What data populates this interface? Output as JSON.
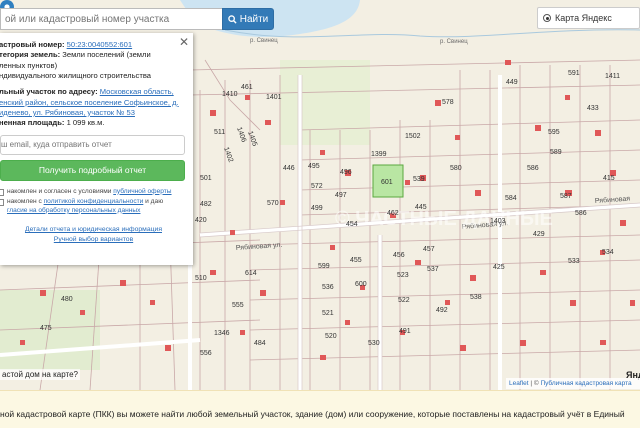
{
  "search": {
    "placeholder": "ой или кадастровый номер участка",
    "button_label": "Найти"
  },
  "map_type": {
    "label": "Карта Яндекс"
  },
  "panel": {
    "cadastral_label": "астровый номер:",
    "cadastral_value": "50:23:0040552:601",
    "category_label": "тегория земель:",
    "category_value_1": "Земли поселений (земли",
    "category_value_2": "ленных пунктов)",
    "use_value": "ндивидуального жилищного строительства",
    "address_label": "льный участок по адресу:",
    "address_line_1": "Московская область,",
    "address_line_2": "енский район, сельское поселение Софьинское, д.",
    "address_line_3": "иденево, ул. Рябиновая, участок № 53",
    "area_label": "ненная площадь:",
    "area_value": "1 099 кв.м.",
    "email_placeholder": "ш email, куда отправить отчет",
    "report_button": "Получить подробный отчет",
    "consent_1_a": "накомлен и согласен с условиями",
    "consent_1_link": "публичной оферты",
    "consent_2_a": "накомлен с",
    "consent_2_link": "политикой конфиденциальности",
    "consent_2_b": "и даю",
    "consent_3_link": "гласие на обработку персональных данных",
    "details_link": "Детали отчета и юридическая информация",
    "manual_link": "Ручной выбор вариантов",
    "close": "✕"
  },
  "map": {
    "river_label_1": "р. Свинец",
    "river_label_2": "р. Свинец",
    "street_1": "Рябиновая ул.",
    "street_2": "Рябиновая ул.",
    "street_3": "Рябиновая",
    "watermark": "© ЧАСТНЫЕ ДАННЫЕ",
    "yandex_fragment": "Янде"
  },
  "question": "астой дом на карте?",
  "attribution": {
    "leaflet": "Leaflet",
    "sep": " | © ",
    "source": "Публичная кадастровая карта"
  },
  "bottom_text": "ной кадастровой карте (ПКК) вы можете найти любой земельный участок, здание (дом) или сооружение, которые поставлены на кадастровый учёт в Единый",
  "plots": [
    {
      "id": "p601",
      "label": "601"
    },
    {
      "id": "p1399",
      "label": "1399"
    },
    {
      "id": "p1502",
      "label": "1502"
    },
    {
      "id": "p539",
      "label": "539"
    },
    {
      "id": "p578",
      "label": "578"
    },
    {
      "id": "p449",
      "label": "449"
    },
    {
      "id": "p591",
      "label": "591"
    },
    {
      "id": "p1411",
      "label": "1411"
    },
    {
      "id": "p462",
      "label": "462"
    },
    {
      "id": "p456",
      "label": "456"
    },
    {
      "id": "p457",
      "label": "457"
    },
    {
      "id": "p537",
      "label": "537"
    },
    {
      "id": "p425",
      "label": "425"
    },
    {
      "id": "p1403",
      "label": "1403"
    },
    {
      "id": "p1401",
      "label": "1401"
    },
    {
      "id": "p499",
      "label": "499"
    },
    {
      "id": "p572",
      "label": "572"
    },
    {
      "id": "p570",
      "label": "570"
    },
    {
      "id": "p599",
      "label": "599"
    },
    {
      "id": "p600",
      "label": "600"
    },
    {
      "id": "p536",
      "label": "536"
    },
    {
      "id": "p455",
      "label": "455"
    },
    {
      "id": "p522",
      "label": "522"
    },
    {
      "id": "p521",
      "label": "521"
    },
    {
      "id": "p520",
      "label": "520"
    },
    {
      "id": "p530",
      "label": "530"
    },
    {
      "id": "p555",
      "label": "555"
    },
    {
      "id": "p480",
      "label": "480"
    },
    {
      "id": "p1346",
      "label": "1346"
    },
    {
      "id": "p484",
      "label": "484"
    },
    {
      "id": "p614",
      "label": "614"
    },
    {
      "id": "p446",
      "label": "446"
    },
    {
      "id": "p495",
      "label": "495"
    },
    {
      "id": "p496",
      "label": "496"
    },
    {
      "id": "p497",
      "label": "497"
    },
    {
      "id": "p454",
      "label": "454"
    },
    {
      "id": "p420",
      "label": "420"
    },
    {
      "id": "p445",
      "label": "445"
    },
    {
      "id": "p580",
      "label": "580"
    },
    {
      "id": "p586",
      "label": "586"
    },
    {
      "id": "p589",
      "label": "589"
    },
    {
      "id": "p587",
      "label": "587"
    },
    {
      "id": "p595",
      "label": "595"
    },
    {
      "id": "p584",
      "label": "584"
    },
    {
      "id": "p433",
      "label": "433"
    },
    {
      "id": "p429",
      "label": "429"
    },
    {
      "id": "p533",
      "label": "533"
    },
    {
      "id": "p534",
      "label": "534"
    },
    {
      "id": "p415",
      "label": "415"
    },
    {
      "id": "p538",
      "label": "538"
    },
    {
      "id": "p523",
      "label": "523"
    },
    {
      "id": "p491",
      "label": "491"
    },
    {
      "id": "p492",
      "label": "492"
    },
    {
      "id": "p556",
      "label": "556"
    },
    {
      "id": "p461",
      "label": "461"
    },
    {
      "id": "p1406",
      "label": "1406"
    },
    {
      "id": "p1402",
      "label": "1402"
    },
    {
      "id": "p1405",
      "label": "1405"
    },
    {
      "id": "p1410",
      "label": "1410"
    },
    {
      "id": "p482",
      "label": "482"
    },
    {
      "id": "p501",
      "label": "501"
    },
    {
      "id": "p475",
      "label": "475"
    },
    {
      "id": "p511",
      "label": "511"
    },
    {
      "id": "p510",
      "label": "510"
    },
    {
      "id": "p586b",
      "label": "586"
    }
  ]
}
